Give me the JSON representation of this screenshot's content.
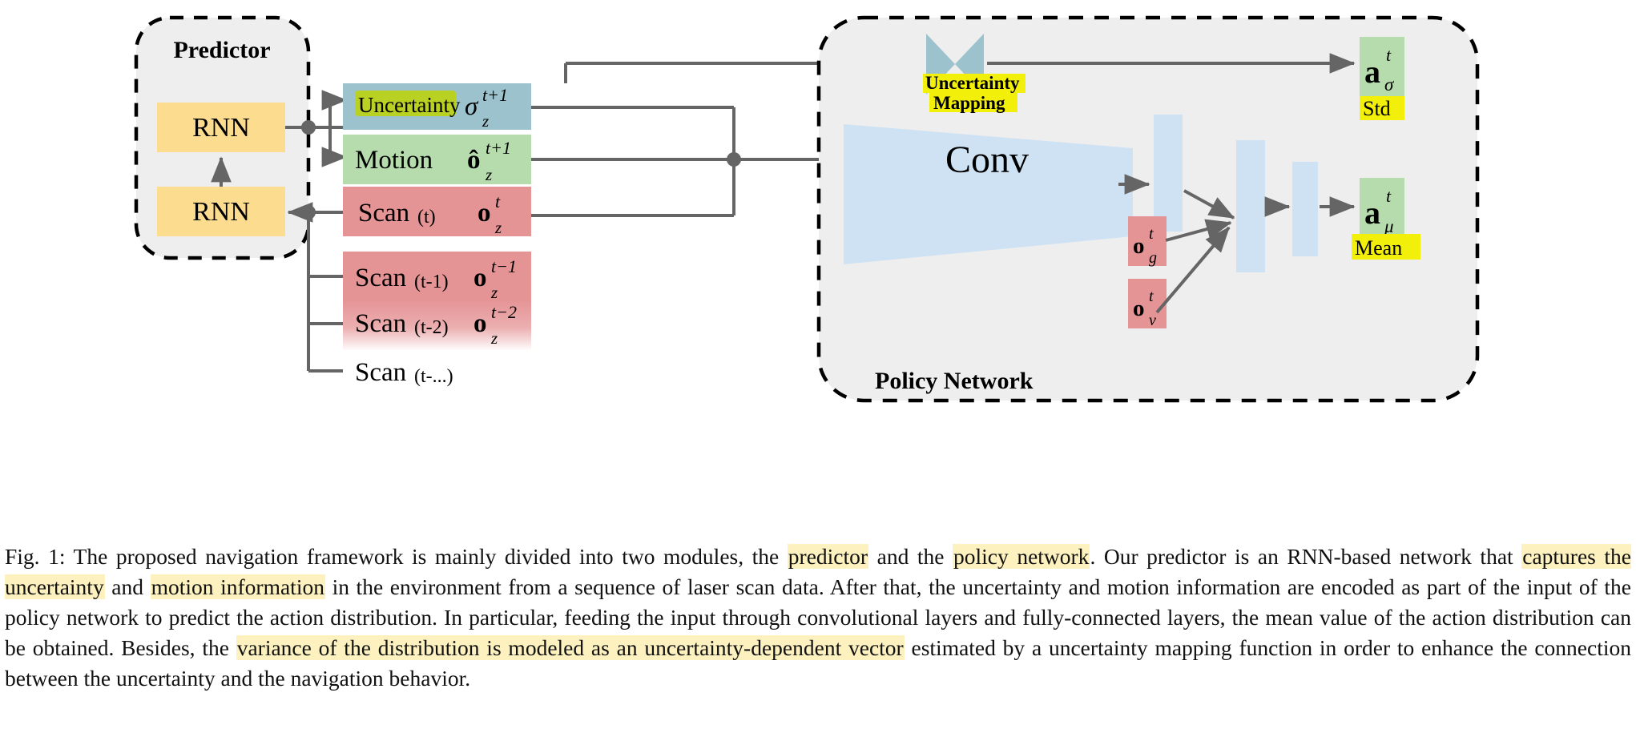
{
  "figure": {
    "modules": {
      "predictor": {
        "title": "Predictor"
      },
      "policy": {
        "title": "Policy Network"
      }
    },
    "predictor_blocks": [
      {
        "name": "rnn-top",
        "label": "RNN"
      },
      {
        "name": "rnn-bottom",
        "label": "RNN"
      }
    ],
    "feature_boxes": [
      {
        "name": "uncertainty-box",
        "label": "Uncertainty",
        "symbol": "σ",
        "sup": "t+1",
        "sub": "z",
        "color": "#9cc3cd",
        "highlight": "#b9d123",
        "highlighted": true
      },
      {
        "name": "motion-box",
        "label": "Motion",
        "symbol": "ô",
        "sup": "t+1",
        "sub": "z",
        "color": "#b6dcae",
        "highlight": "",
        "highlighted": false
      },
      {
        "name": "scan-t-box",
        "label": "Scan",
        "paren": "(t)",
        "symbol": "o",
        "sup": "t",
        "sub": "z",
        "color": "#e59496",
        "highlight": "",
        "highlighted": false
      },
      {
        "name": "scan-t1-box",
        "label": "Scan",
        "paren": "(t-1)",
        "symbol": "o",
        "sup": "t−1",
        "sub": "z",
        "color": "#e59496",
        "highlight": "",
        "highlighted": false
      },
      {
        "name": "scan-t2-box",
        "label": "Scan",
        "paren": "(t-2)",
        "symbol": "o",
        "sup": "t−2",
        "sub": "z",
        "color": "#e59496",
        "highlight": "",
        "highlighted": false
      },
      {
        "name": "scan-tdots-box",
        "label": "Scan",
        "paren": "(t-...)",
        "symbol": "",
        "sup": "",
        "sub": "",
        "color": "none",
        "highlight": "",
        "highlighted": false
      }
    ],
    "policy_blocks": {
      "uncertainty_mapping": {
        "label_line1": "Uncertainty",
        "label_line2": "Mapping",
        "color": "#9cc3cd",
        "highlight": "#f2ef0a"
      },
      "conv": {
        "label": "Conv",
        "color": "#cfe2f3"
      },
      "fc_layers": [
        {
          "name": "fc-1",
          "color": "#cfe2f3"
        },
        {
          "name": "fc-2",
          "color": "#cfe2f3"
        },
        {
          "name": "fc-3",
          "color": "#cfe2f3"
        }
      ],
      "extra_inputs": [
        {
          "name": "goal-input",
          "symbol": "o",
          "sup": "t",
          "sub": "g",
          "color": "#e59496"
        },
        {
          "name": "velocity-input",
          "symbol": "o",
          "sup": "t",
          "sub": "v",
          "color": "#e59496"
        }
      ],
      "outputs": [
        {
          "name": "action-std-output",
          "symbol": "a",
          "sup": "t",
          "sub": "σ",
          "caption": "Std",
          "color": "#b6dcae",
          "highlight": "#f2ef0a"
        },
        {
          "name": "action-mean-output",
          "symbol": "a",
          "sup": "t",
          "sub": "μ",
          "caption": "Mean",
          "color": "#b6dcae",
          "highlight": "#f2ef0a"
        }
      ]
    },
    "colors": {
      "module_fill": "#eeeeee",
      "module_border": "#000000",
      "rnn_fill": "#fcdc8e",
      "line": "#656565",
      "text": "#000000"
    }
  },
  "caption": {
    "segments": [
      {
        "text": "Fig. 1: The proposed navigation framework is mainly divided into two modules, the ",
        "hl": false
      },
      {
        "text": "predictor",
        "hl": true
      },
      {
        "text": " and the ",
        "hl": false
      },
      {
        "text": "policy network",
        "hl": true
      },
      {
        "text": ". Our predictor is an RNN-based network that ",
        "hl": false
      },
      {
        "text": "captures the uncertainty",
        "hl": true
      },
      {
        "text": " and ",
        "hl": false
      },
      {
        "text": "motion information",
        "hl": true
      },
      {
        "text": " in the environment from a sequence of laser scan data. After that, the uncertainty and motion information are encoded as part of the input of the policy network to predict the action distribution. In particular, feeding the input through convolutional layers and fully-connected layers, the mean value of the action distribution can be obtained. Besides, the ",
        "hl": false
      },
      {
        "text": "variance of the distribution is modeled as an uncertainty-dependent vector",
        "hl": true
      },
      {
        "text": " estimated by a uncertainty mapping function in order to enhance the connection between the uncertainty and the navigation behavior.",
        "hl": false
      }
    ]
  }
}
